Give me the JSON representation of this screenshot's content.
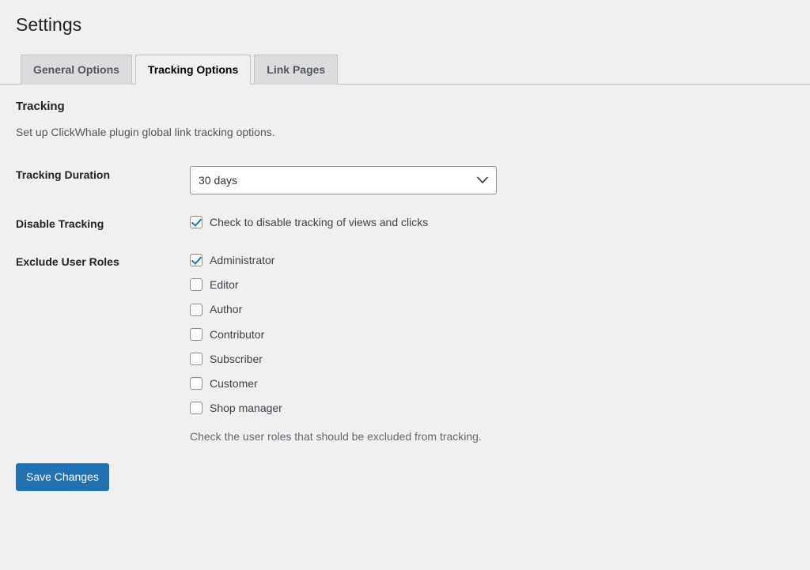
{
  "page": {
    "title": "Settings"
  },
  "tabs": [
    {
      "label": "General Options",
      "active": false
    },
    {
      "label": "Tracking Options",
      "active": true
    },
    {
      "label": "Link Pages",
      "active": false
    }
  ],
  "section": {
    "title": "Tracking",
    "description": "Set up ClickWhale plugin global link tracking options."
  },
  "fields": {
    "tracking_duration": {
      "label": "Tracking Duration",
      "value": "30 days",
      "options": [
        "30 days"
      ],
      "arrow_icon": "chevron-down-icon"
    },
    "disable_tracking": {
      "label": "Disable Tracking",
      "checkbox_label": "Check to disable tracking of views and clicks",
      "checked": true
    },
    "exclude_user_roles": {
      "label": "Exclude User Roles",
      "description": "Check the user roles that should be excluded from tracking.",
      "roles": [
        {
          "label": "Administrator",
          "checked": true
        },
        {
          "label": "Editor",
          "checked": false
        },
        {
          "label": "Author",
          "checked": false
        },
        {
          "label": "Contributor",
          "checked": false
        },
        {
          "label": "Subscriber",
          "checked": false
        },
        {
          "label": "Customer",
          "checked": false
        },
        {
          "label": "Shop manager",
          "checked": false
        }
      ]
    }
  },
  "submit": {
    "label": "Save Changes"
  },
  "colors": {
    "accent": "#2271b1",
    "background": "#f0f0f1",
    "tab_inactive": "#dcdcde",
    "border": "#c3c4c7",
    "text": "#3c434a",
    "heading": "#1d2327"
  }
}
